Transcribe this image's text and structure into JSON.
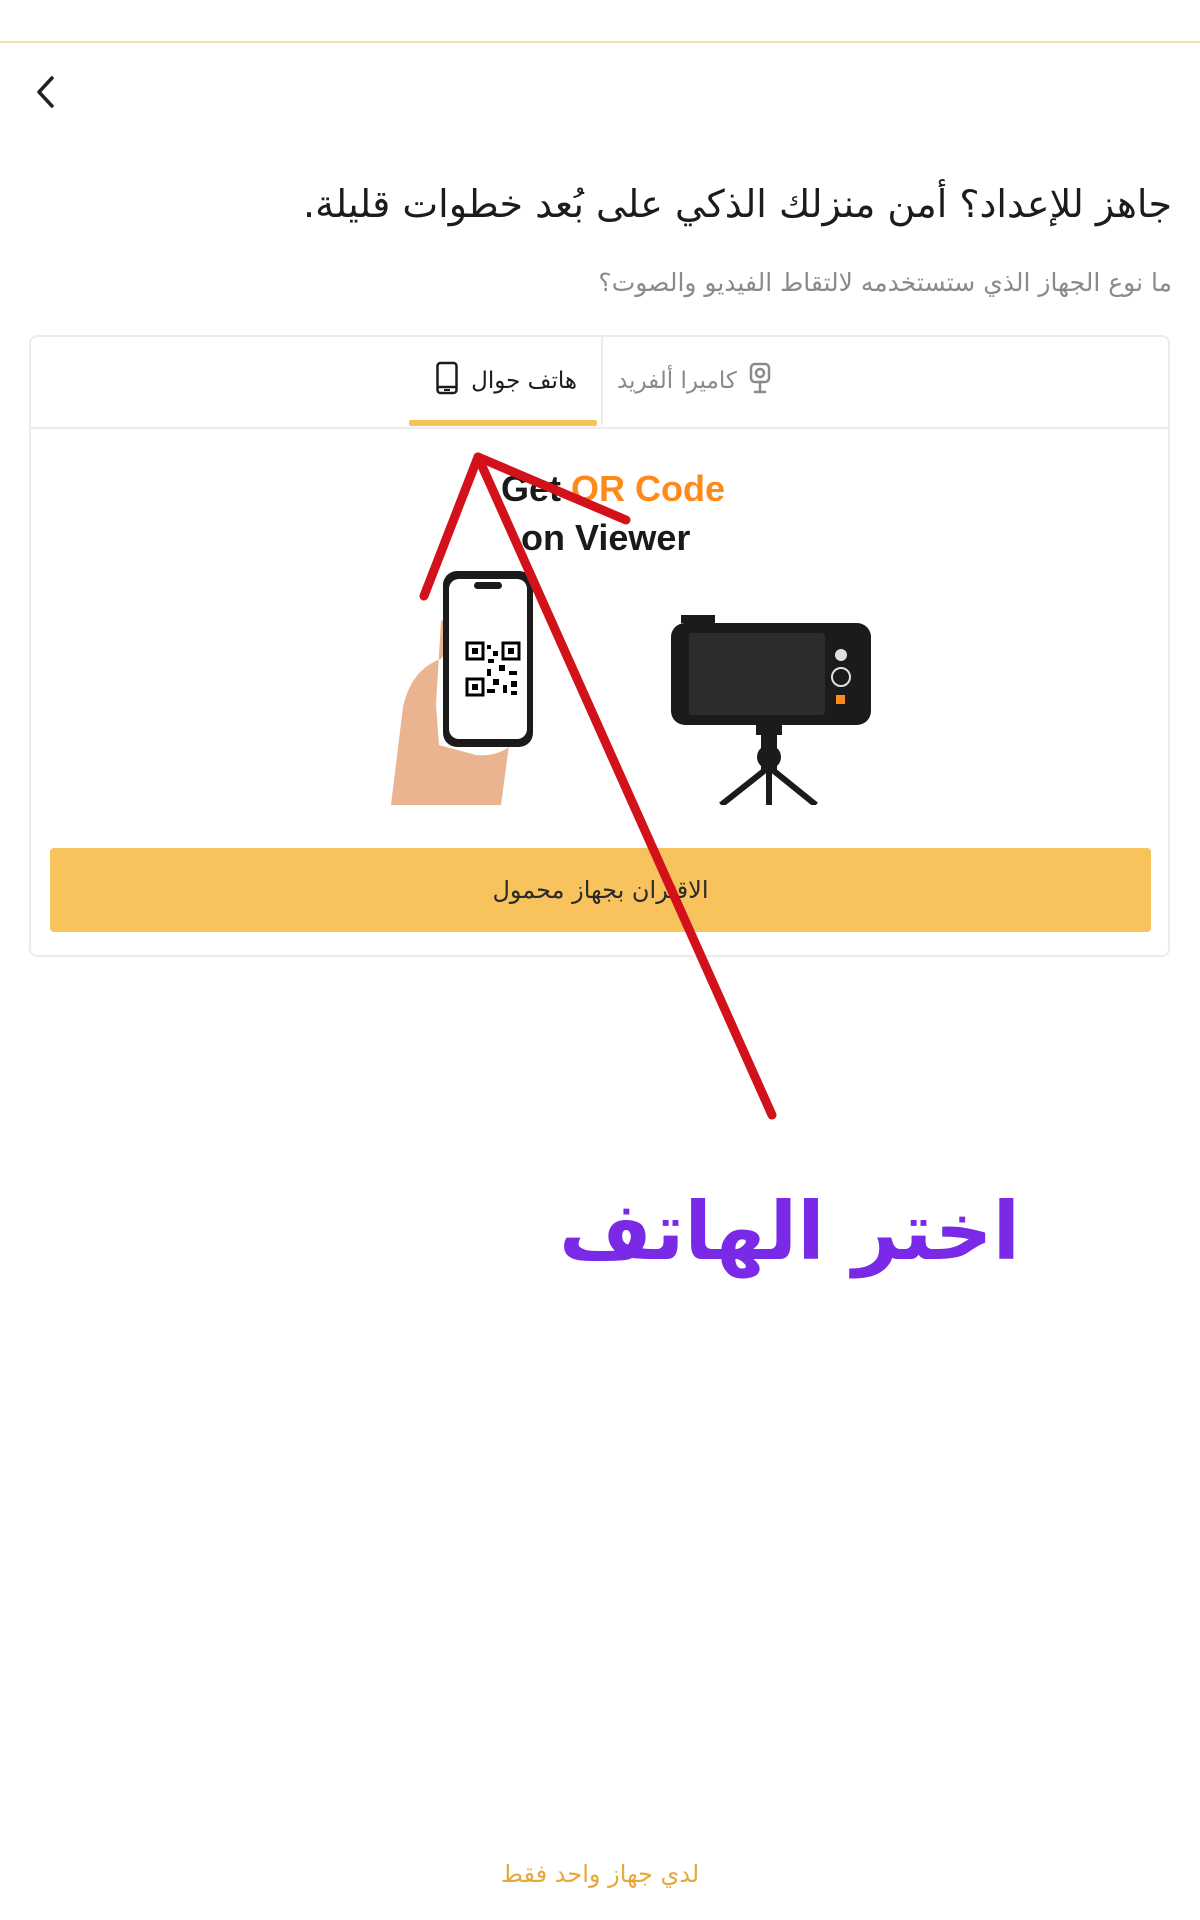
{
  "header": {
    "back_icon": "chevron-left-icon",
    "title": "جاهز للإعداد؟ أمن منزلك الذكي على بُعد خطوات قليلة.",
    "subtitle": "ما نوع الجهاز الذي ستستخدمه لالتقاط الفيديو والصوت؟"
  },
  "tabs": [
    {
      "label": "كاميرا ألفريد",
      "icon": "camera-icon",
      "selected": false
    },
    {
      "label": "هاتف جوال",
      "icon": "phone-icon",
      "selected": true
    }
  ],
  "illustration": {
    "line1_prefix": "Get ",
    "line1_highlight": "QR Code",
    "line2": "on Viewer"
  },
  "pair_button_label": "الاقتران بجهاز محمول",
  "annotation_text": "اختر الهاتف",
  "footer_link": "لدي جهاز واحد فقط",
  "colors": {
    "accent": "#f8c25c",
    "tab_underline": "#f6c35a",
    "annotation": "#7a2ae6",
    "arrow": "#d3111b",
    "link": "#e8a73a",
    "qr_orange": "#ff8a1a"
  }
}
